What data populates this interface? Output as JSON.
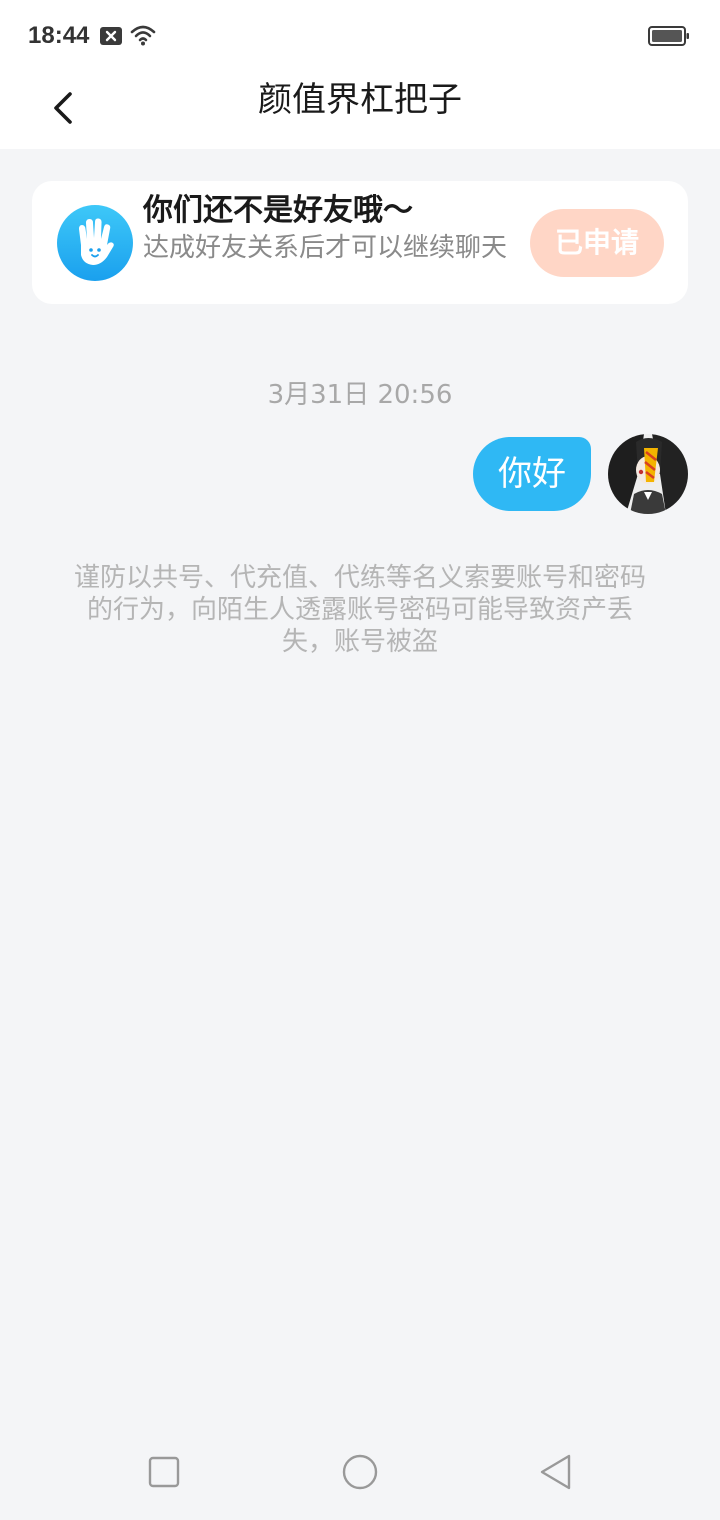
{
  "status_bar": {
    "time": "18:44"
  },
  "header": {
    "title": "颜值界杠把子"
  },
  "friend_notice": {
    "title": "你们还不是好友哦～",
    "description": "达成好友关系后才可以继续聊天",
    "button_label": "已申请"
  },
  "chat": {
    "timestamp": "3月31日 20:56",
    "messages": [
      {
        "text": "你好",
        "sender": "me"
      }
    ]
  },
  "warning_text": "谨防以共号、代充值、代练等名义索要账号和密码的行为，向陌生人透露账号密码可能导致资产丢失，账号被盗",
  "colors": {
    "accent_blue": "#2fb8f4",
    "applied_button": "#ffd6c6",
    "background": "#f4f5f7"
  }
}
